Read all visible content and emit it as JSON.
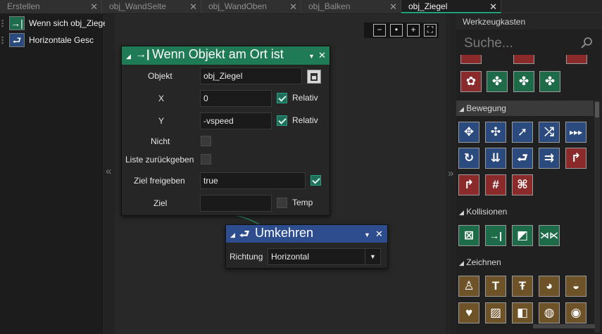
{
  "tabs": [
    {
      "label": "Erstellen",
      "close": "✕"
    },
    {
      "label": "obj_WandSeite",
      "close": "✕"
    },
    {
      "label": "obj_WandOben",
      "close": "✕"
    },
    {
      "label": "obj_Balken",
      "close": "✕"
    },
    {
      "label": "obj_Ziegel",
      "close": "✕"
    }
  ],
  "events": [
    {
      "label": "Wenn sich obj_Ziegel",
      "icon": "arrow-to-bar-icon",
      "glyph": "→|"
    },
    {
      "label": "Horizontale Gesc",
      "icon": "reverse-arrow-icon",
      "glyph": "⮐"
    }
  ],
  "collapse_left": "«",
  "collapse_right": "»",
  "zoom": [
    {
      "icon": "zoom-out-icon",
      "glyph": "−"
    },
    {
      "icon": "zoom-reset-icon",
      "glyph": "•"
    },
    {
      "icon": "zoom-in-icon",
      "glyph": "+"
    },
    {
      "icon": "fit-screen-icon",
      "glyph": "⛶"
    }
  ],
  "block_place": {
    "title": "Wenn Objekt am Ort ist",
    "collapse": "◢",
    "icon_glyph": "→|",
    "dropdown": "▼",
    "close": "✕",
    "fields": {
      "objekt_label": "Objekt",
      "objekt_value": "obj_Ziegel",
      "x_label": "X",
      "x_value": "0",
      "x_rel_label": "Relativ",
      "y_label": "Y",
      "y_value": "-vspeed",
      "y_rel_label": "Relativ",
      "nicht_label": "Nicht",
      "liste_label": "Liste zurückgeben",
      "ziel_frei_label": "Ziel freigeben",
      "ziel_frei_value": "true",
      "ziel_label": "Ziel",
      "ziel_value": "",
      "temp_label": "Temp"
    }
  },
  "block_reverse": {
    "title": "Umkehren",
    "collapse": "◢",
    "icon_glyph": "⮐",
    "dropdown": "▼",
    "close": "✕",
    "richtung_label": "Richtung",
    "richtung_value": "Horizontal",
    "select_arrow": "▼"
  },
  "toolbox": {
    "title": "Werkzeugkasten",
    "search_placeholder": "Suche...",
    "categories": [
      {
        "label": "Bewegung",
        "arrow": "◢"
      },
      {
        "label": "Kollisionen",
        "arrow": "◢"
      },
      {
        "label": "Zeichnen",
        "arrow": "◢"
      }
    ]
  },
  "colors": {
    "green_header": "#1f7a56",
    "blue_header": "#2d4d8f",
    "accent": "#1fa27a"
  }
}
